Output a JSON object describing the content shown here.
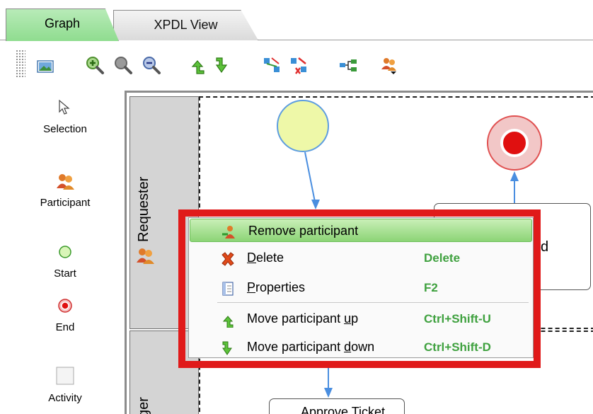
{
  "tabs": [
    {
      "label": "Graph",
      "active": true
    },
    {
      "label": "XPDL View",
      "active": false
    }
  ],
  "toolbar": {
    "icons": [
      "image-icon",
      "zoom-in-icon",
      "zoom-actual-icon",
      "zoom-out-icon",
      "move-up-icon",
      "move-down-icon",
      "connect-icon",
      "disconnect-icon",
      "tree-icon",
      "participant-dropdown-icon"
    ]
  },
  "palette": {
    "items": [
      {
        "label": "Selection",
        "icon": "cursor-icon"
      },
      {
        "label": "Participant",
        "icon": "participant-icon"
      },
      {
        "label": "Start",
        "icon": "start-circle-icon"
      },
      {
        "label": "End",
        "icon": "end-circle-icon"
      },
      {
        "label": "Activity",
        "icon": "activity-box-icon"
      }
    ]
  },
  "canvas": {
    "lanes": [
      {
        "label": "Requester"
      },
      {
        "label": "ger"
      }
    ],
    "activity_partial_text": "d",
    "activity2_label": "Approve Ticket"
  },
  "context_menu": {
    "items": [
      {
        "label": "Remove participant",
        "shortcut": "",
        "icon": "remove-participant-icon",
        "active": true
      },
      {
        "label_pre": "",
        "label_ul": "D",
        "label_post": "elete",
        "shortcut": "Delete",
        "icon": "delete-icon"
      },
      {
        "label_pre": "",
        "label_ul": "P",
        "label_post": "roperties",
        "shortcut": "F2",
        "icon": "properties-icon"
      },
      {
        "label_pre": "Move participant ",
        "label_ul": "u",
        "label_post": "p",
        "shortcut": "Ctrl+Shift-U",
        "icon": "move-up-icon"
      },
      {
        "label_pre": "Move participant ",
        "label_ul": "d",
        "label_post": "own",
        "shortcut": "Ctrl+Shift-D",
        "icon": "move-down-icon"
      }
    ]
  },
  "colors": {
    "active_tab": "#8fdc8f",
    "highlight_box": "#e01a1a",
    "shortcut_text": "#3fa13f",
    "start_fill": "#eef8a8",
    "end_fill": "#f2c7c7"
  }
}
